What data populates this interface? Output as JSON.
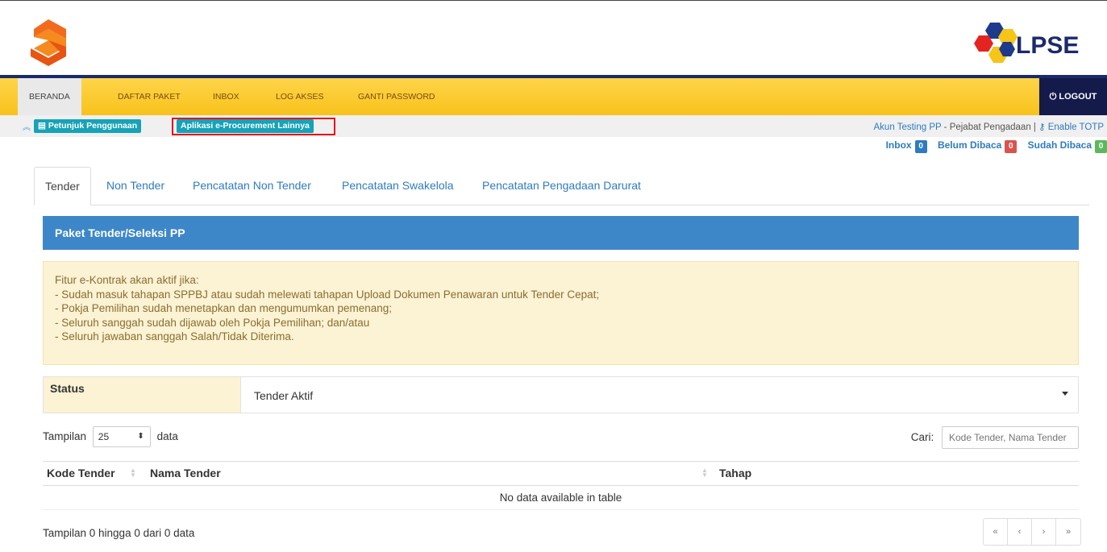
{
  "header": {
    "logo_left": "spse-logo",
    "logo_right_text": "LPSE"
  },
  "nav": {
    "items": [
      {
        "label": "BERANDA",
        "active": true
      },
      {
        "label": "DAFTAR PAKET",
        "active": false
      },
      {
        "label": "INBOX",
        "active": false
      },
      {
        "label": "LOG AKSES",
        "active": false
      },
      {
        "label": "GANTI PASSWORD",
        "active": false
      }
    ],
    "logout_label": "LOGOUT"
  },
  "subbar": {
    "petunjuk_label": "Petunjuk Penggunaan",
    "aplikasi_label": "Aplikasi e-Procurement Lainnya",
    "user_name": "Akun Testing PP",
    "user_role": " - Pejabat Pengadaan | ",
    "totp_label": "Enable TOTP"
  },
  "inbox": {
    "inbox_label": "Inbox",
    "inbox_count": "0",
    "belum_label": "Belum Dibaca",
    "belum_count": "0",
    "sudah_label": "Sudah Dibaca",
    "sudah_count": "0"
  },
  "tabs": [
    {
      "label": "Tender",
      "active": true
    },
    {
      "label": "Non Tender",
      "active": false
    },
    {
      "label": "Pencatatan Non Tender",
      "active": false
    },
    {
      "label": "Pencatatan Swakelola",
      "active": false
    },
    {
      "label": "Pencatatan Pengadaan Darurat",
      "active": false
    }
  ],
  "panel": {
    "title": "Paket Tender/Seleksi PP"
  },
  "alert": {
    "lines": [
      "Fitur e-Kontrak akan aktif jika:",
      "- Sudah masuk tahapan SPPBJ atau sudah melewati tahapan Upload Dokumen Penawaran untuk Tender Cepat;",
      "- Pokja Pemilihan sudah menetapkan dan mengumumkan pemenang;",
      "- Seluruh sanggah sudah dijawab oleh Pokja Pemilihan; dan/atau",
      "- Seluruh jawaban sanggah Salah/Tidak Diterima."
    ]
  },
  "status": {
    "label": "Status",
    "value": "Tender Aktif"
  },
  "table_controls": {
    "tampilan_label": "Tampilan",
    "page_size": "25",
    "data_label": "data",
    "cari_label": "Cari:",
    "search_placeholder": "Kode Tender, Nama Tender"
  },
  "table": {
    "columns": [
      "Kode Tender",
      "Nama Tender",
      "Tahap"
    ],
    "empty_message": "No data available in table"
  },
  "footer": {
    "info": "Tampilan 0 hingga 0 dari 0 data",
    "pager": [
      "«",
      "‹",
      "›",
      "»"
    ]
  },
  "colors": {
    "nav_yellow": "#f7c21c",
    "navy": "#1b2a6b",
    "panel_blue": "#3d87c8",
    "alert_bg": "#fcf3d5",
    "badge_teal": "#17a2b8",
    "badge_blue": "#2f7bbf",
    "badge_red": "#d9534f",
    "badge_green": "#5cb85c"
  }
}
